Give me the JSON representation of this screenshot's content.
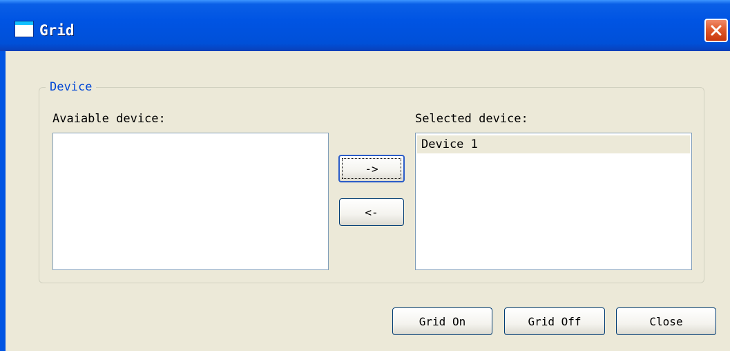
{
  "window": {
    "title": "Grid"
  },
  "group": {
    "legend": "Device",
    "available_label": "Avaiable device:",
    "selected_label": "Selected device:",
    "available_items": [],
    "selected_items": [
      "Device 1"
    ]
  },
  "buttons": {
    "add": "->",
    "remove": "<-",
    "grid_on": "Grid On",
    "grid_off": "Grid Off",
    "close": "Close"
  },
  "colors": {
    "titlebar": "#0054e3",
    "dialog_bg": "#ece9d8",
    "legend_text": "#0046d5",
    "list_border": "#7f9db9",
    "close_button": "#e05a2c"
  }
}
